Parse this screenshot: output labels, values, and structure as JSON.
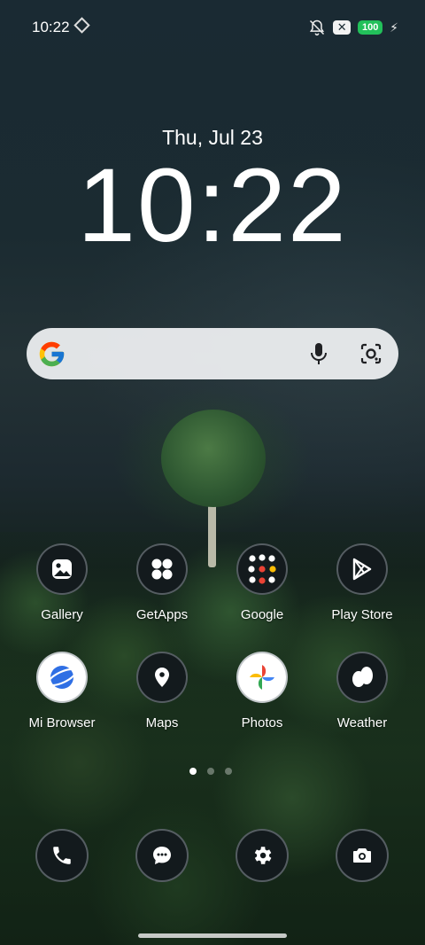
{
  "status_bar": {
    "time": "10:22",
    "battery": "100",
    "icons": [
      "sync-icon",
      "bell-muted-icon",
      "x-app-icon",
      "battery-icon",
      "charging-bolt-icon"
    ],
    "battery_color": "#22c05a"
  },
  "lockscreen": {
    "date": "Thu, Jul 23",
    "time": "10:22"
  },
  "search": {
    "icons": [
      "google-g-icon",
      "microphone-icon",
      "google-lens-icon"
    ]
  },
  "apps": [
    {
      "label": "Gallery",
      "icon": "gallery-icon"
    },
    {
      "label": "GetApps",
      "icon": "getapps-icon"
    },
    {
      "label": "Google",
      "icon": "google-folder-icon"
    },
    {
      "label": "Play Store",
      "icon": "play-store-icon"
    },
    {
      "label": "Mi Browser",
      "icon": "mi-browser-icon"
    },
    {
      "label": "Maps",
      "icon": "maps-icon"
    },
    {
      "label": "Photos",
      "icon": "photos-icon"
    },
    {
      "label": "Weather",
      "icon": "weather-icon"
    }
  ],
  "page_indicator": {
    "pages": 3,
    "current": 1
  },
  "dock": [
    {
      "name": "phone",
      "icon": "phone-icon"
    },
    {
      "name": "messages",
      "icon": "messages-icon"
    },
    {
      "name": "settings",
      "icon": "settings-icon"
    },
    {
      "name": "camera",
      "icon": "camera-icon"
    }
  ]
}
